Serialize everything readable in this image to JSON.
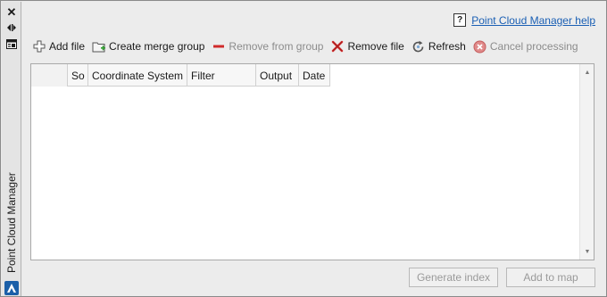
{
  "palette": {
    "title": "Point Cloud Manager",
    "close_icon": "close-icon",
    "autohide_icon": "auto-hide-icon",
    "properties_icon": "properties-icon",
    "logo_icon": "autodesk-logo-icon"
  },
  "help": {
    "icon": "?",
    "link_text": "Point Cloud Manager help"
  },
  "toolbar": {
    "add_file": "Add file",
    "create_merge_group": "Create merge group",
    "remove_from_group": "Remove from group",
    "remove_file": "Remove file",
    "refresh": "Refresh",
    "cancel_processing": "Cancel processing"
  },
  "grid": {
    "columns": [
      "",
      "So",
      "Coordinate System",
      "Filter",
      "Output",
      "Date"
    ],
    "rows": []
  },
  "buttons": {
    "generate_index": "Generate index",
    "add_to_map": "Add to map"
  },
  "colors": {
    "link": "#1a5fb4",
    "add_icon_green": "#2f9e2f",
    "remove_red": "#d02b2b",
    "disabled_text": "#8c8c8c"
  }
}
